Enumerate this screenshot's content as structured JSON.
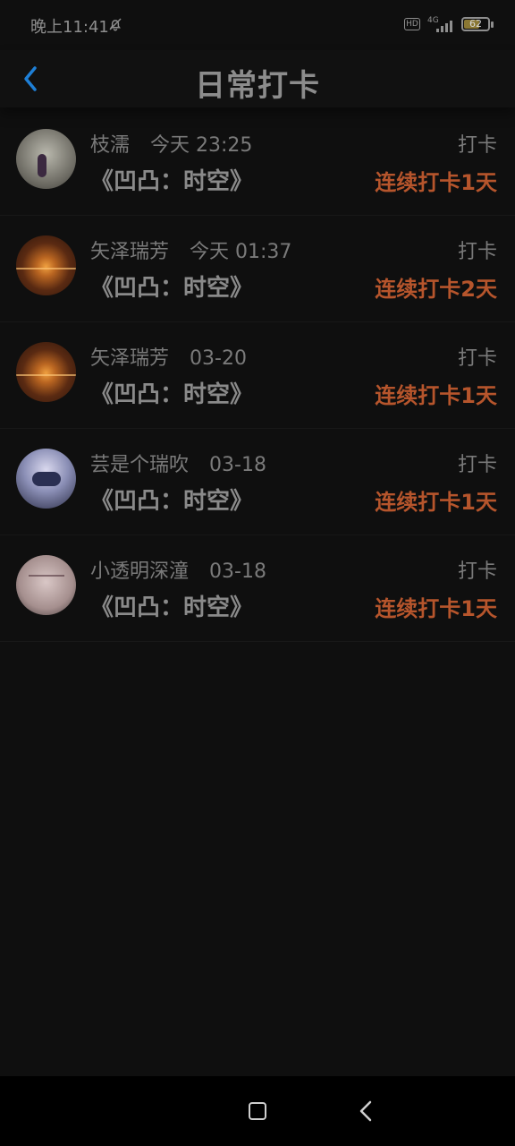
{
  "status_bar": {
    "time": "晚上11:41",
    "battery_level": "62",
    "network": "4G",
    "hd": "HD"
  },
  "app_bar": {
    "title": "日常打卡"
  },
  "entries": [
    {
      "name": "枝濡",
      "time": "今天 23:25",
      "book": "《凹凸：时空》",
      "action": "打卡",
      "streak": "连续打卡1天",
      "avatar_icon": "girl-avatar"
    },
    {
      "name": "矢泽瑞芳",
      "time": "今天 01:37",
      "book": "《凹凸：时空》",
      "action": "打卡",
      "streak": "连续打卡2天",
      "avatar_icon": "sunset-avatar"
    },
    {
      "name": "矢泽瑞芳",
      "time": "03-20",
      "book": "《凹凸：时空》",
      "action": "打卡",
      "streak": "连续打卡1天",
      "avatar_icon": "sunset-avatar"
    },
    {
      "name": "芸是个瑞吹",
      "time": "03-18",
      "book": "《凹凸：时空》",
      "action": "打卡",
      "streak": "连续打卡1天",
      "avatar_icon": "anime-avatar"
    },
    {
      "name": "小透明深潼",
      "time": "03-18",
      "book": "《凹凸：时空》",
      "action": "打卡",
      "streak": "连续打卡1天",
      "avatar_icon": "note-avatar"
    }
  ],
  "colors": {
    "background": "#0f0f0f",
    "accent_blue": "#1e7fd6",
    "streak_orange": "#b6552c"
  }
}
